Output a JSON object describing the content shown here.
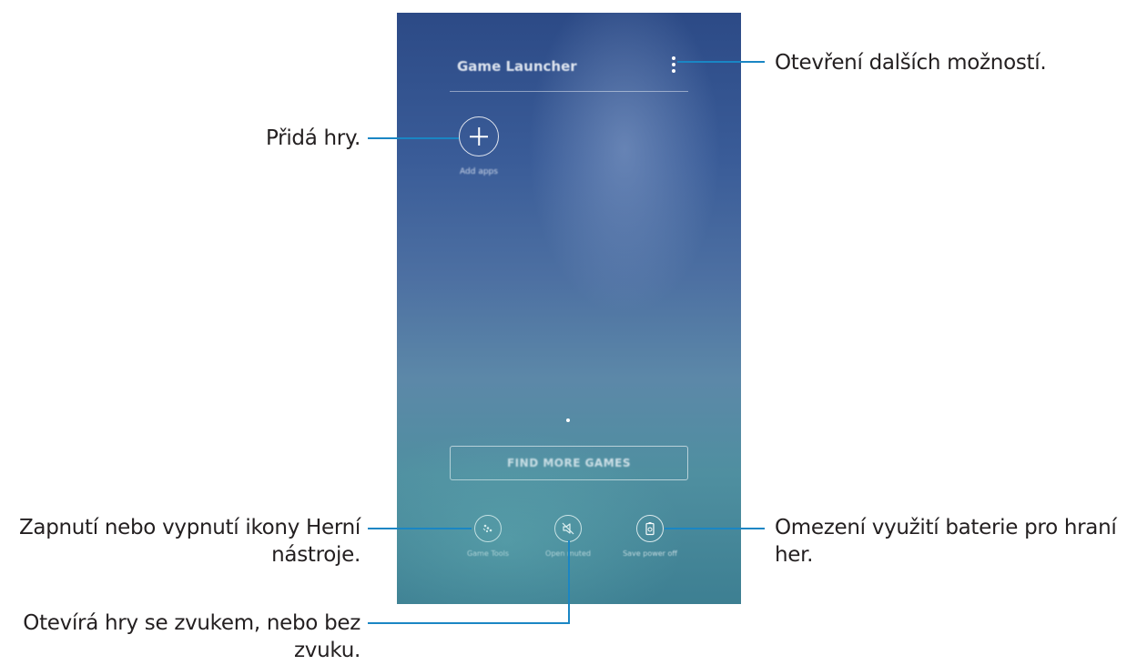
{
  "phone": {
    "app_title": "Game Launcher",
    "add_apps_label": "Add apps",
    "find_more_label": "FIND MORE GAMES",
    "tools": [
      {
        "label": "Game Tools",
        "icon": "game-tools-icon"
      },
      {
        "label": "Open muted",
        "icon": "mute-icon"
      },
      {
        "label": "Save power off",
        "icon": "battery-settings-icon"
      }
    ]
  },
  "callouts": {
    "more_options": "Otevření dalších možností.",
    "add_games": "Přidá hry.",
    "game_tools_line1": "Zapnutí nebo vypnutí ikony Herní",
    "game_tools_line2": "nástroje.",
    "battery_line1": "Omezení využití baterie pro hraní",
    "battery_line2": "her.",
    "sound_line1": "Otevírá hry se zvukem, nebo bez",
    "sound_line2": "zvuku."
  },
  "colors": {
    "callout_line": "#1a86c4",
    "callout_text": "#231f20"
  }
}
